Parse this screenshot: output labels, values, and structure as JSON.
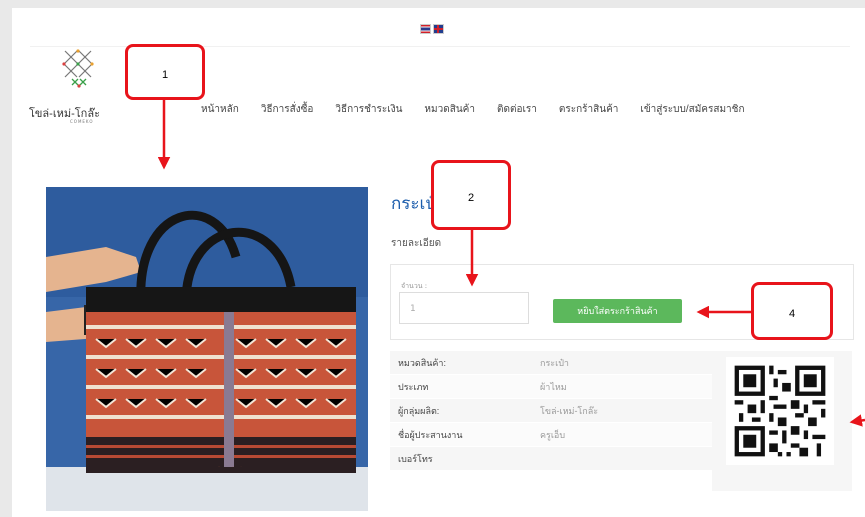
{
  "lang": {
    "thai_flag": "Thai flag",
    "uk_flag": "UK flag"
  },
  "logo": {
    "name": "โขล่-เหม่-โกล๊ะ",
    "sub": "COMEKO"
  },
  "nav": [
    {
      "label": "หน้าหลัก"
    },
    {
      "label": "วิธีการสั่งซื้อ"
    },
    {
      "label": "วิธีการชำระเงิน"
    },
    {
      "label": "หมวดสินค้า"
    },
    {
      "label": "ติดต่อเรา"
    },
    {
      "label": "ตระกร้าสินค้า"
    },
    {
      "label": "เข้าสู่ระบบ/สมัครสมาชิก"
    }
  ],
  "product": {
    "title": "กระเป๋า 3000",
    "detail_label": "รายละเอียด",
    "qty_label": "จำนวน :",
    "qty_value": "1",
    "add_to_cart": "หยิบใส่ตระกร้าสินค้า"
  },
  "info": [
    {
      "key": "หมวดสินค้า:",
      "value": "กระเป๋า"
    },
    {
      "key": "ประเภท",
      "value": "ผ้าไหม"
    },
    {
      "key": "ผู้กลุ่มผลิต:",
      "value": "โขล่-เหม่-โกล๊ะ"
    },
    {
      "key": "ชื่อผู้ประสานงาน",
      "value": "ครูเอ็บ"
    },
    {
      "key": "เบอร์โทร",
      "value": ""
    }
  ],
  "callouts": {
    "c1": "1",
    "c2": "2",
    "c4": "4"
  },
  "colors": {
    "accent": "#1c5dac",
    "button": "#5cb85c",
    "callout": "#e8141b"
  }
}
